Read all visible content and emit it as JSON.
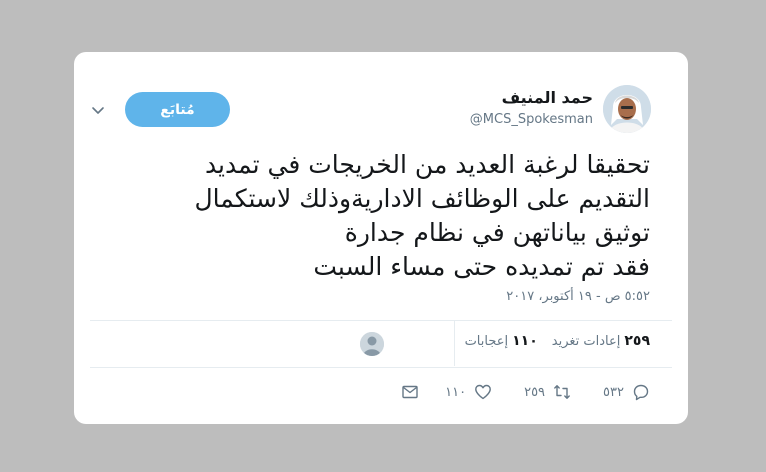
{
  "user": {
    "name": "حمد المنيف",
    "handle": "@MCS_Spokesman"
  },
  "follow_label": "مُتابَع",
  "tweet": {
    "lines": [
      "تحقيقا لرغبة العديد من الخريجات في تمديد",
      "التقديم على الوظائف الاداريةوذلك لاستكمال",
      "توثيق بياناتهن في نظام جدارة",
      "فقد تم تمديده حتى مساء السبت"
    ],
    "timestamp": "٥:٥٢ ص - ١٩ أكتوبر، ٢٠١٧"
  },
  "stats": {
    "retweets_count": "٢٥٩",
    "retweets_label": "إعادات تغريد",
    "likes_count": "١١٠",
    "likes_label": "إعجابات"
  },
  "actions": {
    "reply_count": "٥٣٢",
    "retweet_count": "٢٥٩",
    "like_count": "١١٠"
  },
  "colors": {
    "accent": "#5fb4ea",
    "text": "#14171a",
    "muted": "#657786",
    "background": "#bdbdbd"
  },
  "icons": [
    "chevron-down-icon",
    "reply-icon",
    "retweet-icon",
    "heart-icon",
    "message-icon"
  ]
}
